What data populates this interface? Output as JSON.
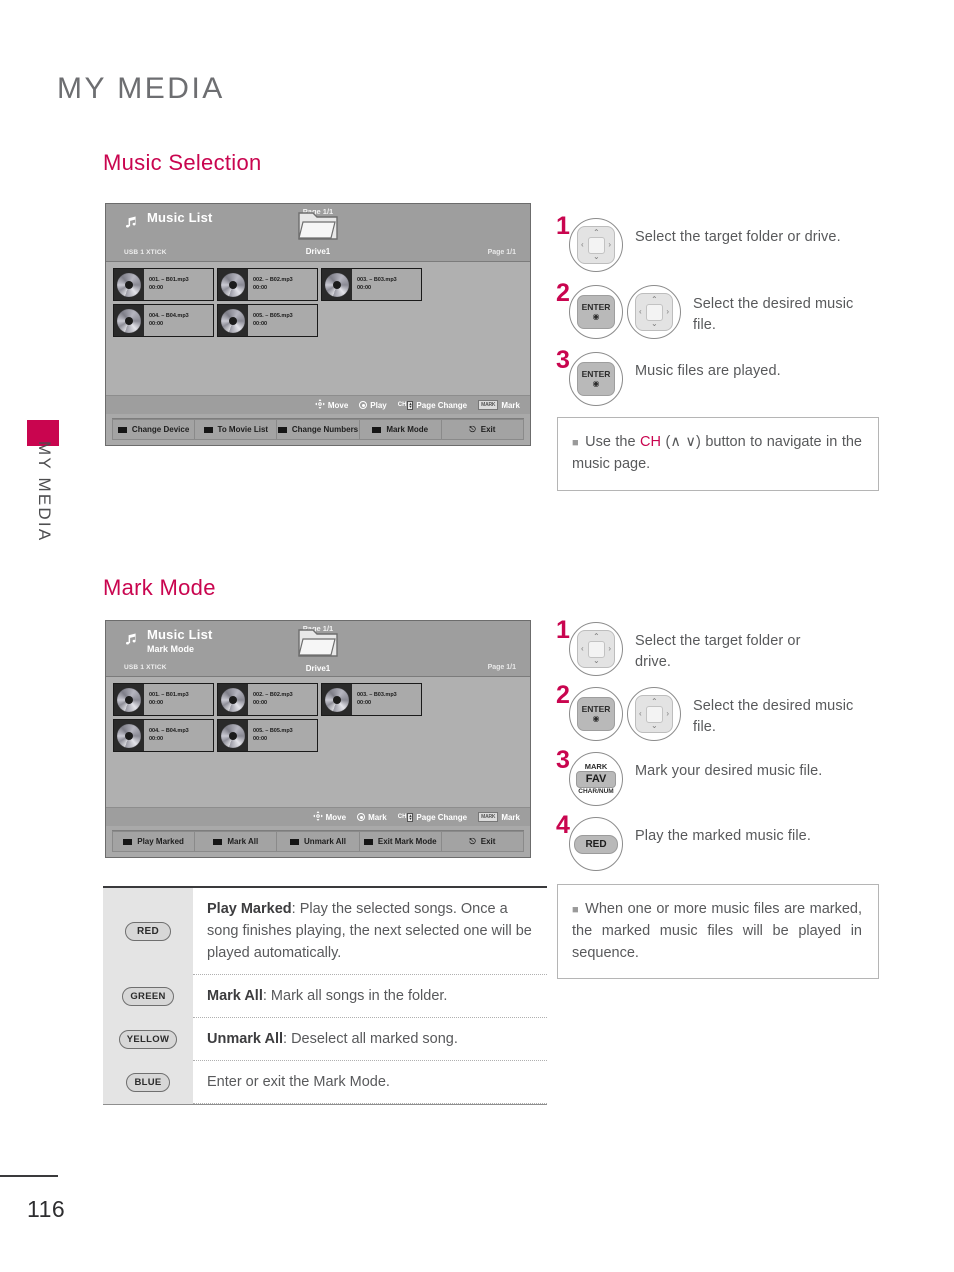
{
  "document": {
    "chapter_title": "MY MEDIA",
    "side_tab_label": "MY MEDIA",
    "page_number": "116",
    "accent_color": "#c9054f"
  },
  "sections": [
    {
      "id": "music-selection",
      "title": "Music Selection"
    },
    {
      "id": "mark-mode",
      "title": "Mark Mode"
    }
  ],
  "osd_music_selection": {
    "title": "Music List",
    "subtitle": "",
    "device": "USB 1 XTICK",
    "folder_label": "Drive1",
    "page_top": "Page 1/1",
    "page_right": "Page 1/1",
    "files": [
      {
        "name": "001. – B01.mp3",
        "time": "00:00"
      },
      {
        "name": "002. – B02.mp3",
        "time": "00:00"
      },
      {
        "name": "003. – B03.mp3",
        "time": "00:00"
      },
      {
        "name": "004. – B04.mp3",
        "time": "00:00"
      },
      {
        "name": "005. – B05.mp3",
        "time": "00:00"
      }
    ],
    "nav_hints": [
      {
        "icon": "dpad-icon",
        "label": "Move"
      },
      {
        "icon": "enter-dot-icon",
        "label": "Play"
      },
      {
        "icon": "ch-updown-icon",
        "label": "Page Change"
      },
      {
        "icon": "mark-badge-icon",
        "label": "Mark"
      }
    ],
    "color_buttons": [
      {
        "color": "black",
        "label": "Change Device"
      },
      {
        "color": "black",
        "label": "To Movie List"
      },
      {
        "color": "black",
        "label": "Change Numbers"
      },
      {
        "color": "black",
        "label": "Mark Mode"
      },
      {
        "color": "none",
        "label": "Exit"
      }
    ]
  },
  "osd_mark_mode": {
    "title": "Music List",
    "subtitle": "Mark Mode",
    "device": "USB 1 XTICK",
    "folder_label": "Drive1",
    "page_top": "Page 1/1",
    "page_right": "Page 1/1",
    "files": [
      {
        "name": "001. – B01.mp3",
        "time": "00:00"
      },
      {
        "name": "002. – B02.mp3",
        "time": "00:00"
      },
      {
        "name": "003. – B03.mp3",
        "time": "00:00"
      },
      {
        "name": "004. – B04.mp3",
        "time": "00:00"
      },
      {
        "name": "005. – B05.mp3",
        "time": "00:00"
      }
    ],
    "nav_hints": [
      {
        "icon": "dpad-icon",
        "label": "Move"
      },
      {
        "icon": "enter-dot-icon",
        "label": "Mark"
      },
      {
        "icon": "ch-updown-icon",
        "label": "Page Change"
      },
      {
        "icon": "mark-badge-icon",
        "label": "Mark"
      }
    ],
    "color_buttons": [
      {
        "color": "black",
        "label": "Play Marked"
      },
      {
        "color": "black",
        "label": "Mark All"
      },
      {
        "color": "black",
        "label": "Unmark All"
      },
      {
        "color": "black",
        "label": "Exit Mark Mode"
      },
      {
        "color": "none",
        "label": "Exit"
      }
    ]
  },
  "steps_music_selection": [
    {
      "num": "1",
      "buttons": [
        "dpad"
      ],
      "text": "Select the target folder or drive."
    },
    {
      "num": "2",
      "buttons": [
        "enter",
        "dpad"
      ],
      "text": "Select the desired music file."
    },
    {
      "num": "3",
      "buttons": [
        "enter"
      ],
      "text": "Music files are played."
    }
  ],
  "steps_mark_mode": [
    {
      "num": "1",
      "buttons": [
        "dpad"
      ],
      "text": "Select the target folder or drive."
    },
    {
      "num": "2",
      "buttons": [
        "enter",
        "dpad"
      ],
      "text": "Select the desired music file."
    },
    {
      "num": "3",
      "buttons": [
        "fav"
      ],
      "text": "Mark your desired music file."
    },
    {
      "num": "4",
      "buttons": [
        "red"
      ],
      "text": "Play the marked music file."
    }
  ],
  "remote_button_labels": {
    "enter_top": "ENTER",
    "enter_bottom": "◉",
    "fav_top": "MARK",
    "fav_mid": "FAV",
    "fav_bottom": "CHAR/NUM",
    "red": "RED"
  },
  "notes": {
    "note1_prefix": "Use the ",
    "note1_accent": "CH",
    "note1_suffix": " (∧ ∨) button to navigate in the music page.",
    "note2": "When one or more music files are marked, the marked music files will be played in sequence."
  },
  "color_key_table": [
    {
      "pill": "RED",
      "bold": "Play Marked",
      "text": ": Play the selected songs. Once a song finishes playing, the next selected one will be played automatically."
    },
    {
      "pill": "GREEN",
      "bold": "Mark All",
      "text": ": Mark all songs in the folder."
    },
    {
      "pill": "YELLOW",
      "bold": "Unmark All",
      "text": ": Deselect all marked song."
    },
    {
      "pill": "BLUE",
      "bold": "",
      "text": "Enter or exit the Mark Mode."
    }
  ]
}
